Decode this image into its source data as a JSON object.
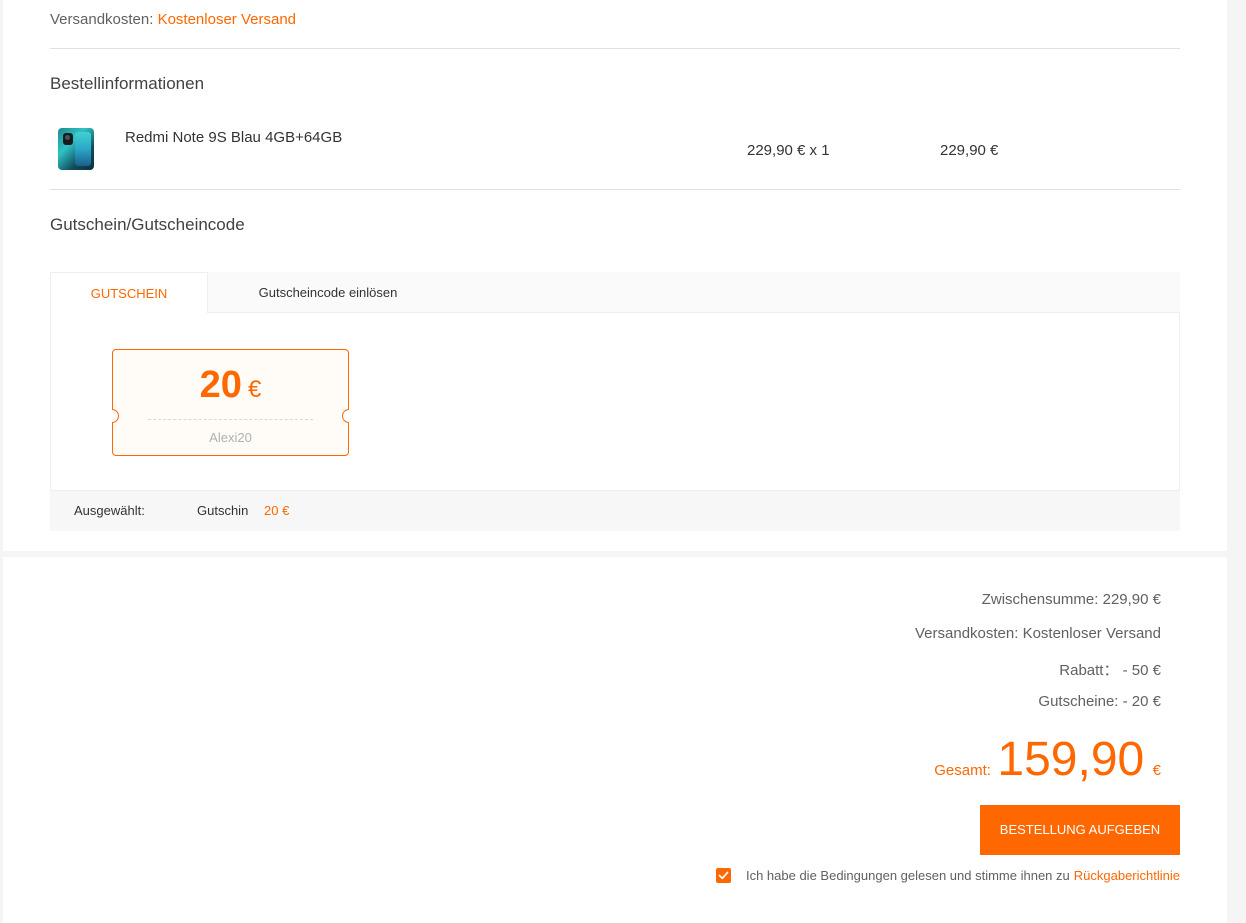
{
  "shipping": {
    "label": "Versandkosten:",
    "value": "Kostenloser Versand"
  },
  "order_info": {
    "title": "Bestellinformationen",
    "product": {
      "icon": "phone-product-thumbnail",
      "name": "Redmi Note 9S Blau 4GB+64GB",
      "unit_price_qty": "229,90 € x 1",
      "total": "229,90 €"
    }
  },
  "coupon": {
    "title": "Gutschein/Gutscheincode",
    "tabs": [
      {
        "label": "GUTSCHEIN",
        "active": true
      },
      {
        "label": "Gutscheincode einlösen",
        "active": false
      }
    ],
    "ticket": {
      "amount": "20",
      "currency": "€",
      "code": "Alexi20"
    },
    "selected": {
      "label": "Ausgewählt:",
      "type": "Gutschin",
      "value": "20 €"
    }
  },
  "summary": {
    "subtotal": "Zwischensumme: 229,90 €",
    "shipping": "Versandkosten: Kostenloser Versand",
    "discount": "Rabatt：  - 50 €",
    "vouchers": "Gutscheine: - 20 €",
    "total_label": "Gesamt:",
    "total_value": "159,90",
    "total_currency": "€"
  },
  "order_button": {
    "label": "BESTELLUNG AUFGEBEN"
  },
  "terms": {
    "checked": true,
    "text": "Ich habe die Bedingungen gelesen und stimme ihnen zu",
    "link": "Rückgaberichtlinie"
  },
  "colors": {
    "accent": "#ff6700",
    "text": "#424242",
    "muted": "#616161",
    "background": "#f5f5f5"
  }
}
